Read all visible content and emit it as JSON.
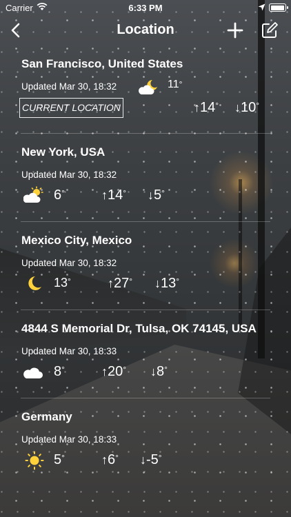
{
  "status_bar": {
    "carrier": "Carrier",
    "time": "6:33 PM"
  },
  "nav": {
    "title": "Location"
  },
  "locations": [
    {
      "name": "San Francisco, United States",
      "updated": "Updated Mar 30, 18:32",
      "icon": "partly-cloudy-night-icon",
      "temp": "11",
      "high": "14",
      "low": "10",
      "badge": "CURRENT LOCATION"
    },
    {
      "name": "New York, USA",
      "updated": "Updated Mar 30, 18:32",
      "icon": "partly-cloudy-day-icon",
      "temp": "6",
      "high": "14",
      "low": "5"
    },
    {
      "name": "Mexico City, Mexico",
      "updated": "Updated Mar 30, 18:32",
      "icon": "moon-icon",
      "temp": "13",
      "high": "27",
      "low": "13"
    },
    {
      "name": "4844 S Memorial Dr, Tulsa, OK 74145, USA",
      "updated": "Updated Mar 30, 18:33",
      "icon": "cloud-icon",
      "temp": "8",
      "high": "20",
      "low": "8"
    },
    {
      "name": "Germany",
      "updated": "Updated Mar 30, 18:33",
      "icon": "sun-icon",
      "temp": "5",
      "high": "6",
      "low": "-5"
    }
  ],
  "symbols": {
    "degree": "°",
    "up": "↑",
    "down": "↓"
  },
  "colors": {
    "sun": "#ffd23c",
    "moon": "#ffd23c",
    "text": "#ffffff"
  }
}
